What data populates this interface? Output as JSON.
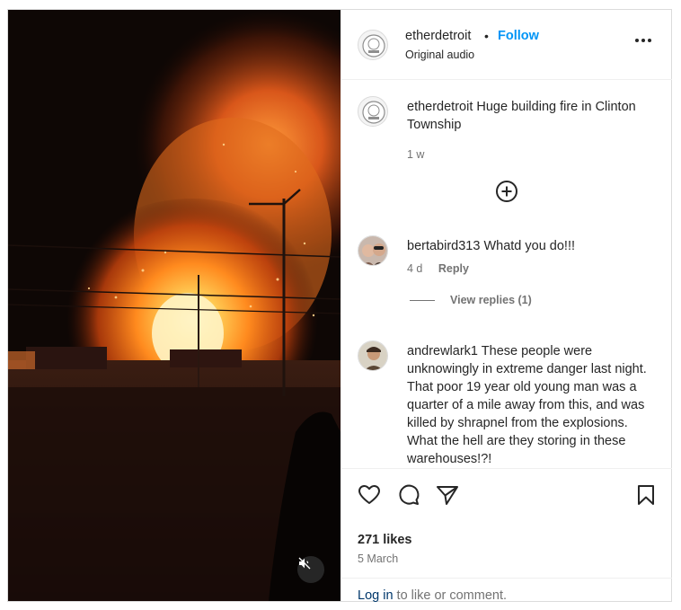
{
  "post": {
    "username": "etherdetroit",
    "separator": "•",
    "follow_label": "Follow",
    "audio_label": "Original audio",
    "caption": "Huge building fire in Clinton Township",
    "caption_age": "1 w",
    "likes": "271 likes",
    "date": "5 March"
  },
  "comments": [
    {
      "username": "bertabird313",
      "text": "Whatd you do!!!",
      "age": "4 d",
      "reply_label": "Reply"
    },
    {
      "username": "andrewlark1",
      "text": "These people were unknowingly in extreme danger last night. That poor 19 year old young man was a quarter of a mile away from this, and was killed by shrapnel from the explosions. What the hell are they storing in these warehouses!?!"
    }
  ],
  "view_replies_label": "View replies (1)",
  "footer": {
    "login_label": "Log in",
    "login_suffix": " to like or comment."
  },
  "icons": {
    "more": "more-options-icon",
    "load_more": "plus-circle-icon",
    "like": "heart-icon",
    "comment": "comment-icon",
    "share": "paper-plane-icon",
    "save": "bookmark-icon",
    "mute": "speaker-muted-icon"
  },
  "colors": {
    "accent": "#0095f6",
    "link": "#00376b",
    "muted_text": "#737373",
    "fire": "#ff8a1e"
  }
}
